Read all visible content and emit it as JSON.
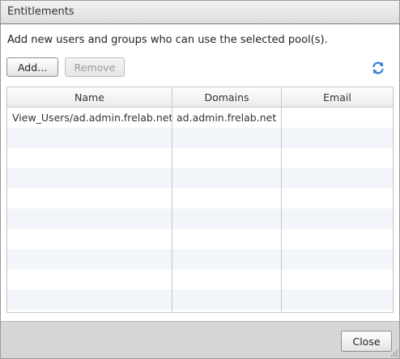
{
  "window": {
    "title": "Entitlements"
  },
  "instructions": "Add new users and groups who can use the selected pool(s).",
  "toolbar": {
    "add_label": "Add...",
    "remove_label": "Remove",
    "refresh_icon": "refresh-icon"
  },
  "table": {
    "columns": [
      "Name",
      "Domains",
      "Email"
    ],
    "rows": [
      {
        "name": "View_Users/ad.admin.frelab.net",
        "domains": "ad.admin.frelab.net",
        "email": ""
      },
      {
        "name": "",
        "domains": "",
        "email": ""
      },
      {
        "name": "",
        "domains": "",
        "email": ""
      },
      {
        "name": "",
        "domains": "",
        "email": ""
      },
      {
        "name": "",
        "domains": "",
        "email": ""
      },
      {
        "name": "",
        "domains": "",
        "email": ""
      },
      {
        "name": "",
        "domains": "",
        "email": ""
      },
      {
        "name": "",
        "domains": "",
        "email": ""
      },
      {
        "name": "",
        "domains": "",
        "email": ""
      },
      {
        "name": "",
        "domains": "",
        "email": ""
      }
    ]
  },
  "footer": {
    "close_label": "Close"
  },
  "colors": {
    "refresh_blue": "#2f7ed8",
    "alt_row": "#f2f5f9"
  }
}
